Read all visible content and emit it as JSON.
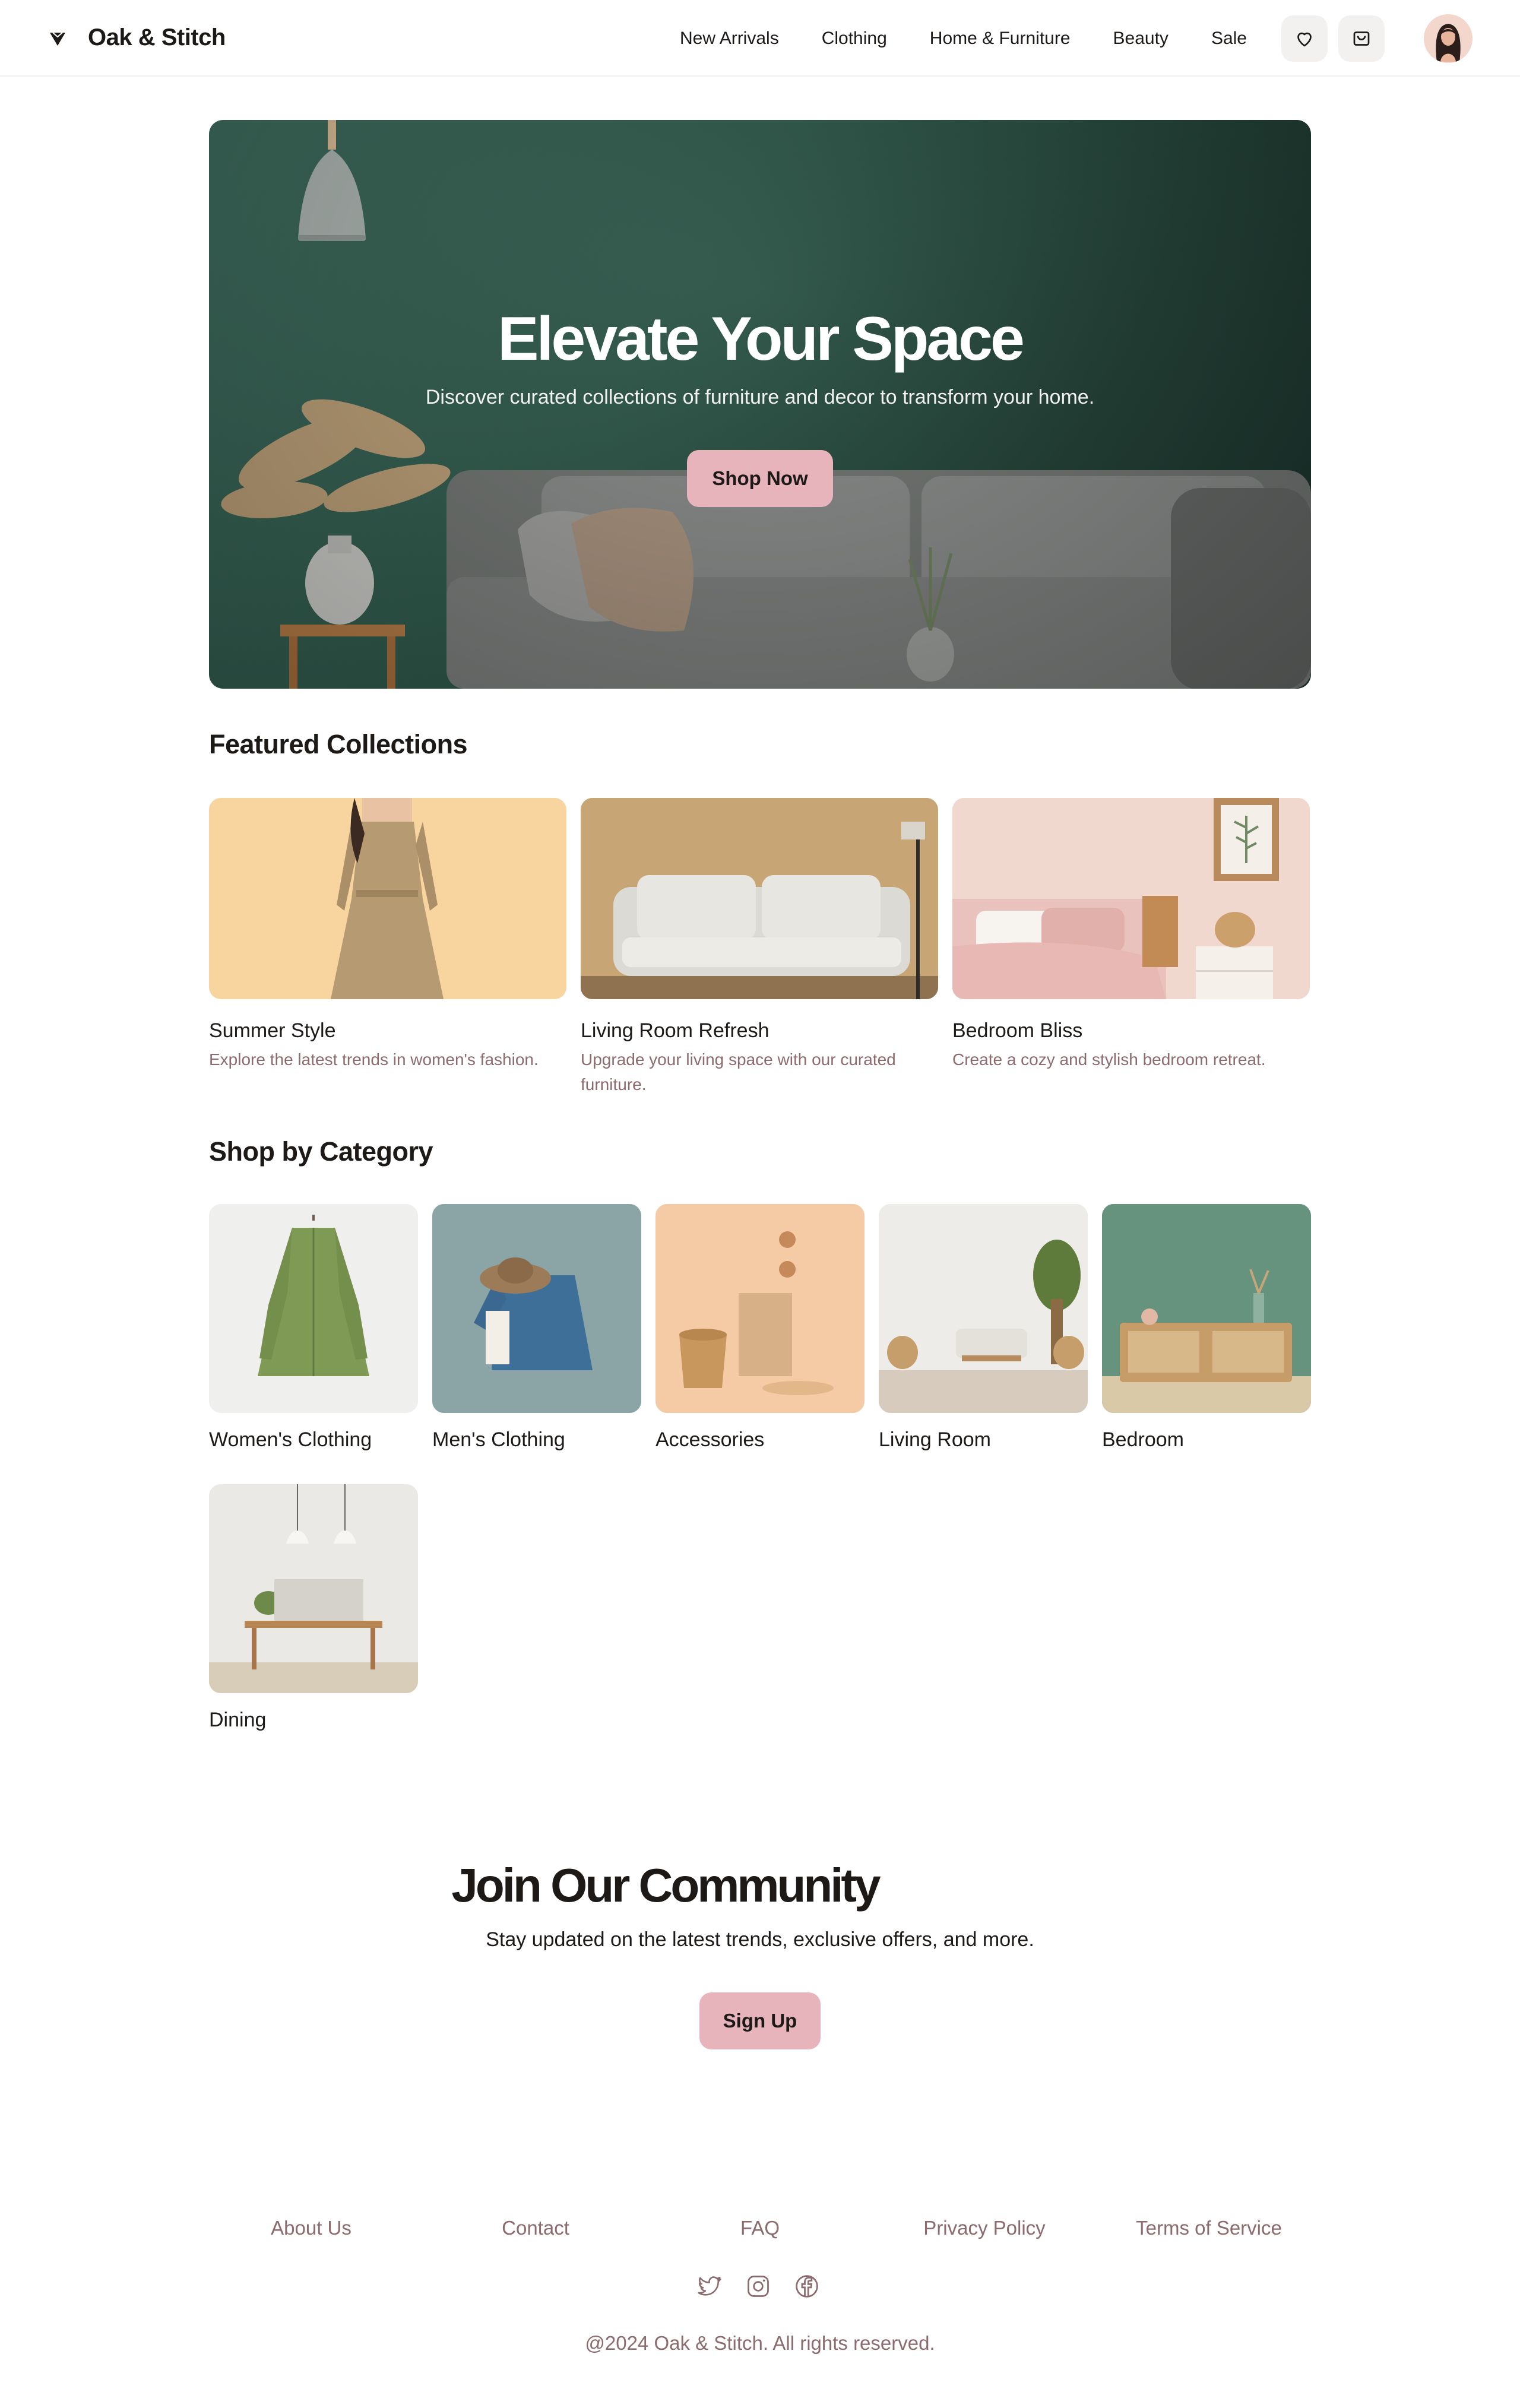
{
  "header": {
    "brand": "Oak & Stitch",
    "nav": [
      "New Arrivals",
      "Clothing",
      "Home & Furniture",
      "Beauty",
      "Sale"
    ],
    "icons": [
      "heart-icon",
      "cart-icon"
    ]
  },
  "hero": {
    "title": "Elevate Your Space",
    "subtitle": "Discover curated collections of furniture and decor to transform your home.",
    "button": "Shop Now"
  },
  "featured": {
    "title": "Featured Collections",
    "items": [
      {
        "title": "Summer Style",
        "desc": "Explore the latest trends in women's fashion."
      },
      {
        "title": "Living Room Refresh",
        "desc": "Upgrade your living space with our curated furniture."
      },
      {
        "title": "Bedroom Bliss",
        "desc": "Create a cozy and stylish bedroom retreat."
      }
    ]
  },
  "categories": {
    "title": "Shop by Category",
    "items": [
      "Women's Clothing",
      "Men's Clothing",
      "Accessories",
      "Living Room",
      "Bedroom",
      "Dining"
    ]
  },
  "community": {
    "title": "Join Our Community",
    "subtitle": "Stay updated on the latest trends, exclusive offers, and more.",
    "button": "Sign Up"
  },
  "footer": {
    "links": [
      "About Us",
      "Contact",
      "FAQ",
      "Privacy Policy",
      "Terms of Service"
    ],
    "social": [
      "twitter-icon",
      "instagram-icon",
      "facebook-icon"
    ],
    "copyright": "@2024 Oak & Stitch. All rights reserved."
  },
  "colors": {
    "accent": "#e8b4bb",
    "muted_text": "#8b6b6e",
    "hero_green": "#2d5749"
  }
}
